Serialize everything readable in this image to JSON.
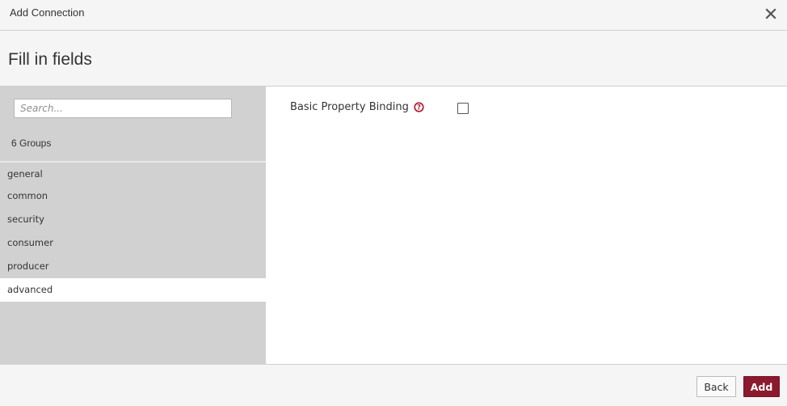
{
  "dialog": {
    "title": "Add Connection",
    "heading": "Fill in fields"
  },
  "sidebar": {
    "search_placeholder": "Search...",
    "search_value": "",
    "groups_count": "6 Groups",
    "items": [
      {
        "label": "general"
      },
      {
        "label": "common"
      },
      {
        "label": "security"
      },
      {
        "label": "consumer"
      },
      {
        "label": "producer"
      },
      {
        "label": "advanced",
        "active": true
      }
    ]
  },
  "main": {
    "property_label": "Basic Property Binding",
    "property_checked": false
  },
  "footer": {
    "back_label": "Back",
    "add_label": "Add"
  },
  "colors": {
    "accent": "#8b1a2f",
    "sidebar_bg": "#d1d1d1",
    "help_icon": "#b0172e"
  },
  "icons": {
    "close": "close-icon",
    "help": "help-icon"
  }
}
